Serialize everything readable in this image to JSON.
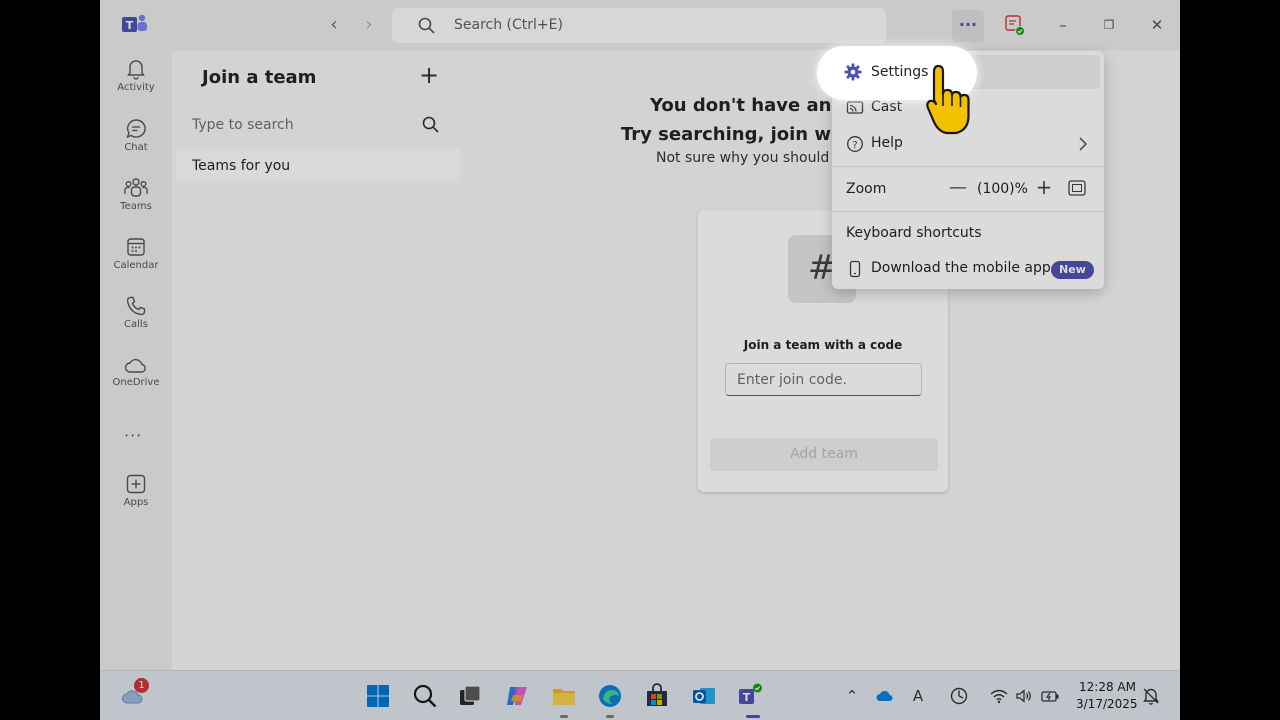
{
  "app": {
    "search_placeholder": "Search (Ctrl+E)",
    "more_options": "···"
  },
  "rail": {
    "items": [
      {
        "label": "Activity",
        "icon": "bell-icon"
      },
      {
        "label": "Chat",
        "icon": "chat-icon"
      },
      {
        "label": "Teams",
        "icon": "people-icon"
      },
      {
        "label": "Calendar",
        "icon": "calendar-icon"
      },
      {
        "label": "Calls",
        "icon": "phone-icon"
      },
      {
        "label": "OneDrive",
        "icon": "cloud-icon"
      }
    ],
    "more": "···",
    "apps_label": "Apps"
  },
  "side_panel": {
    "title": "Join a team",
    "search_placeholder": "Type to search",
    "items": [
      "Teams for you"
    ]
  },
  "main": {
    "title_line1": "You don't have any t",
    "title_line2": "Try searching, join with",
    "subtitle": "Not sure why you should c",
    "card": {
      "symbol": "#",
      "title": "Join a team with a code",
      "input_placeholder": "Enter join code.",
      "button": "Add team"
    }
  },
  "menu": {
    "settings": "Settings",
    "cast": "Cast",
    "help": "Help",
    "zoom_label": "Zoom",
    "zoom_minus": "—",
    "zoom_value": "(100)%",
    "zoom_plus": "+",
    "keyboard_shortcuts": "Keyboard shortcuts",
    "download_app": "Download the mobile app",
    "new_badge": "New"
  },
  "taskbar": {
    "weather_badge": "1",
    "tray_font": "A",
    "time": "12:28 AM",
    "date": "3/17/2025"
  },
  "colors": {
    "brand": "#4f52b2",
    "background": "#ebebeb",
    "badge": "#d13438"
  }
}
